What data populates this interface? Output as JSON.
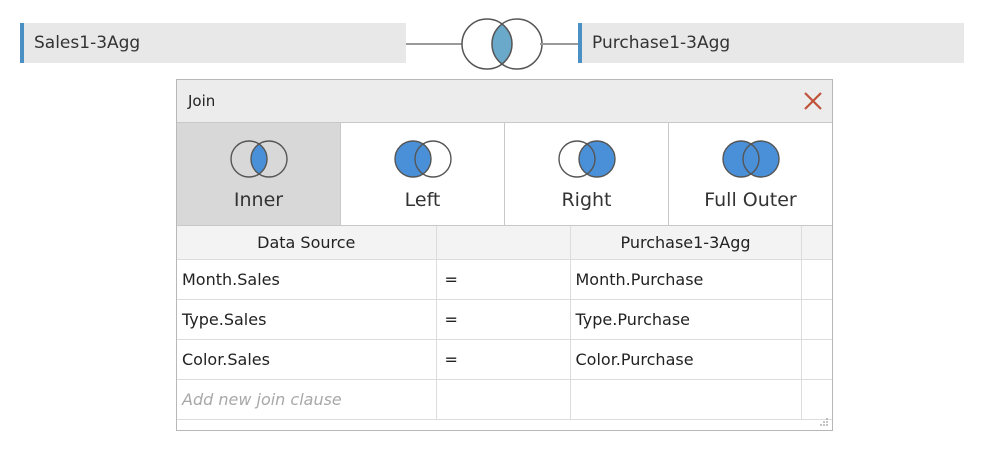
{
  "join_bar": {
    "left_source": "Sales1-3Agg",
    "right_source": "Purchase1-3Agg"
  },
  "dialog": {
    "title": "Join",
    "join_types": [
      {
        "label": "Inner",
        "icon": "inner-join-icon",
        "selected": true
      },
      {
        "label": "Left",
        "icon": "left-join-icon",
        "selected": false
      },
      {
        "label": "Right",
        "icon": "right-join-icon",
        "selected": false
      },
      {
        "label": "Full Outer",
        "icon": "full-outer-join-icon",
        "selected": false
      }
    ],
    "columns": [
      "Data Source",
      "",
      "Purchase1-3Agg",
      ""
    ],
    "clauses": [
      {
        "left": "Month.Sales",
        "op": "=",
        "right": "Month.Purchase"
      },
      {
        "left": "Type.Sales",
        "op": "=",
        "right": "Type.Purchase"
      },
      {
        "left": "Color.Sales",
        "op": "=",
        "right": "Color.Purchase"
      }
    ],
    "add_clause_placeholder": "Add new join clause"
  },
  "colors": {
    "accent": "#4a90c4",
    "venn_fill": "#4a90d9",
    "venn_main_fill": "#6aa9c9",
    "close_x": "#c0543a",
    "selected_bg": "#d8d8d8"
  }
}
